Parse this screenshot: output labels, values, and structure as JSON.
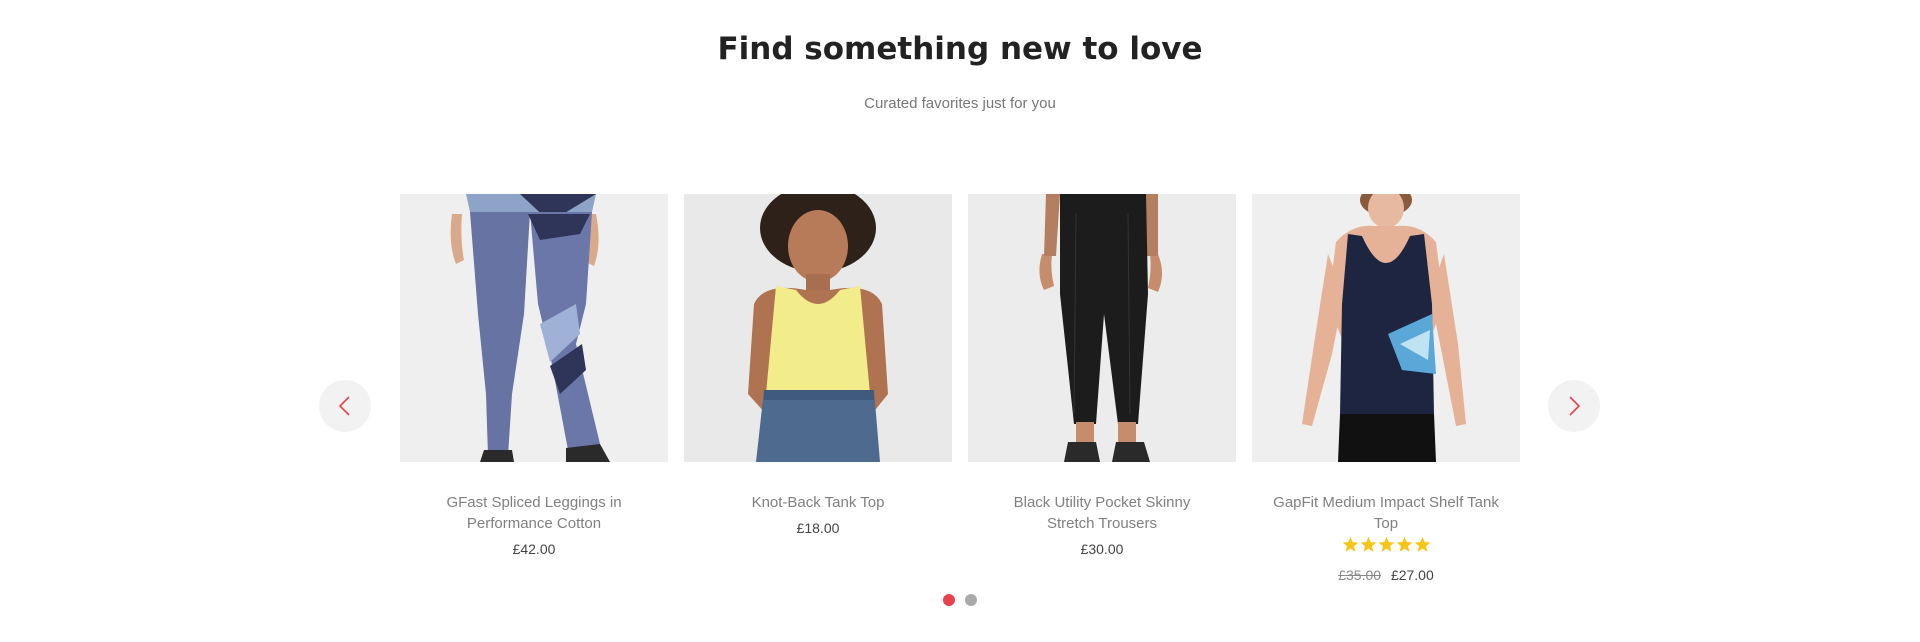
{
  "section": {
    "title": "Find something new to love",
    "subtitle": "Curated favorites just for you"
  },
  "carousel": {
    "prev_icon": "chevron-left-icon",
    "next_icon": "chevron-right-icon",
    "arrow_color": "#e8424c",
    "active_dot_color": "#e8424c",
    "inactive_dot_color": "#aaaaaa",
    "page_count": 2,
    "active_page": 1
  },
  "products": [
    {
      "name": "GFast Spliced Leggings in Performance Cotton",
      "price": "£42.00"
    },
    {
      "name": "Knot-Back Tank Top",
      "price": "£18.00"
    },
    {
      "name": "Black Utility Pocket Skinny Stretch Trousers",
      "price": "£30.00"
    },
    {
      "name": "GapFit Medium Impact Shelf Tank Top",
      "rating": 5,
      "rating_max": 5,
      "star_color": "#f5c518",
      "old_price": "£35.00",
      "price": "£27.00"
    }
  ]
}
